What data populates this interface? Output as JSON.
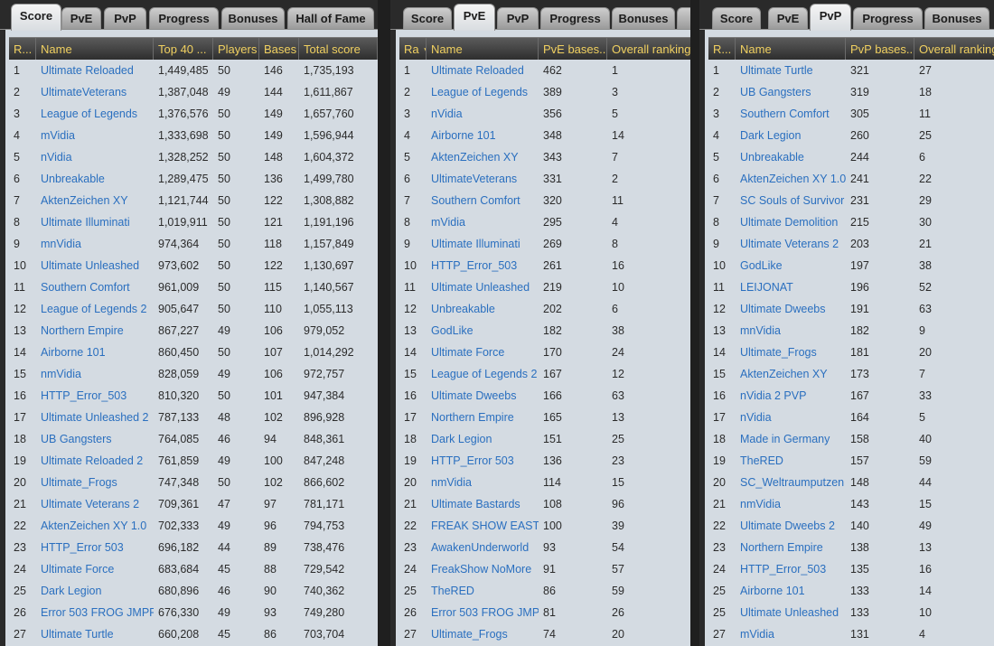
{
  "panels": [
    {
      "tabs": [
        "Score",
        "PvE",
        "PvP",
        "Progress",
        "Bonuses",
        "Hall of Fame"
      ],
      "active_tab": 0,
      "columns": [
        "R...",
        "Name",
        "Top 40 ...",
        "Players",
        "Bases",
        "Total score"
      ],
      "rows": [
        [
          "1",
          "Ultimate Reloaded",
          "1,449,485",
          "50",
          "146",
          "1,735,193"
        ],
        [
          "2",
          "UltimateVeterans",
          "1,387,048",
          "49",
          "144",
          "1,611,867"
        ],
        [
          "3",
          "League of Legends",
          "1,376,576",
          "50",
          "149",
          "1,657,760"
        ],
        [
          "4",
          "mVidia",
          "1,333,698",
          "50",
          "149",
          "1,596,944"
        ],
        [
          "5",
          "nVidia",
          "1,328,252",
          "50",
          "148",
          "1,604,372"
        ],
        [
          "6",
          "Unbreakable",
          "1,289,475",
          "50",
          "136",
          "1,499,780"
        ],
        [
          "7",
          "AktenZeichen XY",
          "1,121,744",
          "50",
          "122",
          "1,308,882"
        ],
        [
          "8",
          "Ultimate Illuminati",
          "1,019,911",
          "50",
          "121",
          "1,191,196"
        ],
        [
          "9",
          "mnVidia",
          "974,364",
          "50",
          "118",
          "1,157,849"
        ],
        [
          "10",
          "Ultimate Unleashed",
          "973,602",
          "50",
          "122",
          "1,130,697"
        ],
        [
          "11",
          "Southern Comfort",
          "961,009",
          "50",
          "115",
          "1,140,567"
        ],
        [
          "12",
          "League of Legends 2",
          "905,647",
          "50",
          "110",
          "1,055,113"
        ],
        [
          "13",
          "Northern Empire",
          "867,227",
          "49",
          "106",
          "979,052"
        ],
        [
          "14",
          "Airborne 101",
          "860,450",
          "50",
          "107",
          "1,014,292"
        ],
        [
          "15",
          "nmVidia",
          "828,059",
          "49",
          "106",
          "972,757"
        ],
        [
          "16",
          "HTTP_Error_503",
          "810,320",
          "50",
          "101",
          "947,384"
        ],
        [
          "17",
          "Ultimate Unleashed 2",
          "787,133",
          "48",
          "102",
          "896,928"
        ],
        [
          "18",
          "UB Gangsters",
          "764,085",
          "46",
          "94",
          "848,361"
        ],
        [
          "19",
          "Ultimate Reloaded 2",
          "761,859",
          "49",
          "100",
          "847,248"
        ],
        [
          "20",
          "Ultimate_Frogs",
          "747,348",
          "50",
          "102",
          "866,602"
        ],
        [
          "21",
          "Ultimate Veterans 2",
          "709,361",
          "47",
          "97",
          "781,171"
        ],
        [
          "22",
          "AktenZeichen XY 1.0",
          "702,333",
          "49",
          "96",
          "794,753"
        ],
        [
          "23",
          "HTTP_Error 503",
          "696,182",
          "44",
          "89",
          "738,476"
        ],
        [
          "24",
          "Ultimate Force",
          "683,684",
          "45",
          "88",
          "729,542"
        ],
        [
          "25",
          "Dark Legion",
          "680,896",
          "46",
          "90",
          "740,362"
        ],
        [
          "26",
          "Error 503 FROG JMPRS",
          "676,330",
          "49",
          "93",
          "749,280"
        ],
        [
          "27",
          "Ultimate Turtle",
          "660,208",
          "45",
          "86",
          "703,704"
        ]
      ]
    },
    {
      "tabs": [
        "Score",
        "PvE",
        "PvP",
        "Progress",
        "Bonuses"
      ],
      "active_tab": 1,
      "columns": [
        "Ra",
        "Name",
        "PvE bases...",
        "Overall ranking"
      ],
      "sort_indicator": "▼",
      "rows": [
        [
          "1",
          "Ultimate Reloaded",
          "462",
          "1"
        ],
        [
          "2",
          "League of Legends",
          "389",
          "3"
        ],
        [
          "3",
          "nVidia",
          "356",
          "5"
        ],
        [
          "4",
          "Airborne 101",
          "348",
          "14"
        ],
        [
          "5",
          "AktenZeichen XY",
          "343",
          "7"
        ],
        [
          "6",
          "UltimateVeterans",
          "331",
          "2"
        ],
        [
          "7",
          "Southern Comfort",
          "320",
          "11"
        ],
        [
          "8",
          "mVidia",
          "295",
          "4"
        ],
        [
          "9",
          "Ultimate Illuminati",
          "269",
          "8"
        ],
        [
          "10",
          "HTTP_Error_503",
          "261",
          "16"
        ],
        [
          "11",
          "Ultimate Unleashed",
          "219",
          "10"
        ],
        [
          "12",
          "Unbreakable",
          "202",
          "6"
        ],
        [
          "13",
          "GodLike",
          "182",
          "38"
        ],
        [
          "14",
          "Ultimate Force",
          "170",
          "24"
        ],
        [
          "15",
          "League of Legends 2",
          "167",
          "12"
        ],
        [
          "16",
          "Ultimate Dweebs",
          "166",
          "63"
        ],
        [
          "17",
          "Northern Empire",
          "165",
          "13"
        ],
        [
          "18",
          "Dark Legion",
          "151",
          "25"
        ],
        [
          "19",
          "HTTP_Error 503",
          "136",
          "23"
        ],
        [
          "20",
          "nmVidia",
          "114",
          "15"
        ],
        [
          "21",
          "Ultimate Bastards",
          "108",
          "96"
        ],
        [
          "22",
          "FREAK SHOW EAST",
          "100",
          "39"
        ],
        [
          "23",
          "AwakenUnderworld",
          "93",
          "54"
        ],
        [
          "24",
          "FreakShow NoMore",
          "91",
          "57"
        ],
        [
          "25",
          "TheRED",
          "86",
          "59"
        ],
        [
          "26",
          "Error 503 FROG JMPRS",
          "81",
          "26"
        ],
        [
          "27",
          "Ultimate_Frogs",
          "74",
          "20"
        ]
      ]
    },
    {
      "tabs": [
        "Score",
        "PvE",
        "PvP",
        "Progress",
        "Bonuses"
      ],
      "active_tab": 2,
      "columns": [
        "R...",
        "Name",
        "PvP bases...",
        "Overall ranking"
      ],
      "rows": [
        [
          "1",
          "Ultimate Turtle",
          "321",
          "27"
        ],
        [
          "2",
          "UB Gangsters",
          "319",
          "18"
        ],
        [
          "3",
          "Southern Comfort",
          "305",
          "11"
        ],
        [
          "4",
          "Dark Legion",
          "260",
          "25"
        ],
        [
          "5",
          "Unbreakable",
          "244",
          "6"
        ],
        [
          "6",
          "AktenZeichen XY 1.0",
          "241",
          "22"
        ],
        [
          "7",
          "SC Souls of Survivor",
          "231",
          "29"
        ],
        [
          "8",
          "Ultimate Demolition",
          "215",
          "30"
        ],
        [
          "9",
          "Ultimate Veterans 2",
          "203",
          "21"
        ],
        [
          "10",
          "GodLike",
          "197",
          "38"
        ],
        [
          "11",
          "LEIJONAT",
          "196",
          "52"
        ],
        [
          "12",
          "Ultimate Dweebs",
          "191",
          "63"
        ],
        [
          "13",
          "mnVidia",
          "182",
          "9"
        ],
        [
          "14",
          "Ultimate_Frogs",
          "181",
          "20"
        ],
        [
          "15",
          "AktenZeichen XY",
          "173",
          "7"
        ],
        [
          "16",
          "nVidia 2 PVP",
          "167",
          "33"
        ],
        [
          "17",
          "nVidia",
          "164",
          "5"
        ],
        [
          "18",
          "Made in Germany",
          "158",
          "40"
        ],
        [
          "19",
          "TheRED",
          "157",
          "59"
        ],
        [
          "20",
          "SC_Weltraumputzen",
          "148",
          "44"
        ],
        [
          "21",
          "nmVidia",
          "143",
          "15"
        ],
        [
          "22",
          "Ultimate Dweebs 2",
          "140",
          "49"
        ],
        [
          "23",
          "Northern Empire",
          "138",
          "13"
        ],
        [
          "24",
          "HTTP_Error_503",
          "135",
          "16"
        ],
        [
          "25",
          "Airborne 101",
          "133",
          "14"
        ],
        [
          "25",
          "Ultimate Unleashed",
          "133",
          "10"
        ],
        [
          "27",
          "mVidia",
          "131",
          "4"
        ]
      ]
    }
  ],
  "colors": {
    "link": "#2a6fbf",
    "header_text": "#f0d060",
    "grid_bg": "#d4dbe2",
    "row_text": "#2b2b2b"
  }
}
